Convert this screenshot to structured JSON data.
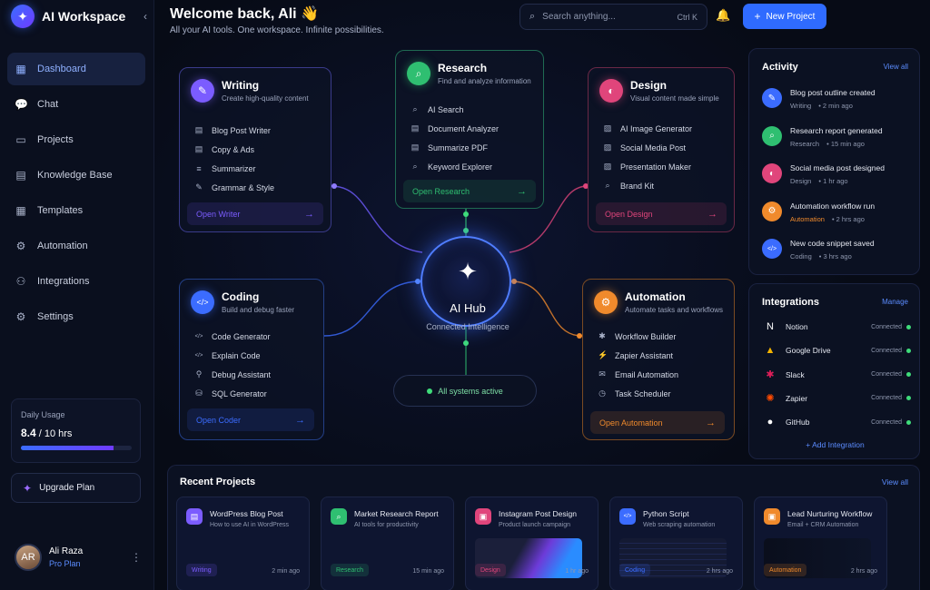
{
  "app": {
    "title": "AI Workspace",
    "collapse_icon": "chevron-left-icon"
  },
  "sidebar": {
    "items": [
      {
        "label": "Dashboard",
        "icon": "grid-icon",
        "glyph": "▦",
        "active": true
      },
      {
        "label": "Chat",
        "icon": "chat-icon",
        "glyph": "💬",
        "active": false
      },
      {
        "label": "Projects",
        "icon": "folder-icon",
        "glyph": "▭",
        "active": false
      },
      {
        "label": "Knowledge Base",
        "icon": "book-icon",
        "glyph": "▤",
        "active": false
      },
      {
        "label": "Templates",
        "icon": "template-icon",
        "glyph": "▦",
        "active": false
      },
      {
        "label": "Automation",
        "icon": "automation-icon",
        "glyph": "⚙",
        "active": false
      },
      {
        "label": "Integrations",
        "icon": "integrations-icon",
        "glyph": "⚇",
        "active": false
      },
      {
        "label": "Settings",
        "icon": "gear-icon",
        "glyph": "⚙",
        "active": false
      }
    ],
    "usage": {
      "label": "Daily Usage",
      "value": "8.4",
      "total": "/ 10 hrs",
      "fraction": 0.84
    },
    "upgrade_label": "Upgrade Plan",
    "user": {
      "name": "Ali Raza",
      "plan": "Pro Plan",
      "initials": "AR"
    }
  },
  "header": {
    "title": "Welcome back, Ali 👋",
    "subtitle": "All your AI tools. One workspace. Infinite possibilities.",
    "search_placeholder": "Search anything...",
    "search_shortcut": "Ctrl K",
    "new_project_label": "New Project"
  },
  "hub": {
    "title": "AI Hub",
    "subtitle": "Connected Intelligence",
    "status": "All systems active"
  },
  "cards": {
    "writing": {
      "title": "Writing",
      "subtitle": "Create high-quality content",
      "items": [
        "Blog Post Writer",
        "Copy & Ads",
        "Summarizer",
        "Grammar & Style"
      ],
      "button": "Open Writer",
      "color": "#7b5cff"
    },
    "research": {
      "title": "Research",
      "subtitle": "Find and analyze information",
      "items": [
        "AI Search",
        "Document Analyzer",
        "Summarize PDF",
        "Keyword Explorer"
      ],
      "button": "Open Research",
      "color": "#2fbf71"
    },
    "design": {
      "title": "Design",
      "subtitle": "Visual content made simple",
      "items": [
        "AI Image Generator",
        "Social Media Post",
        "Presentation Maker",
        "Brand Kit"
      ],
      "button": "Open Design",
      "color": "#e0457b"
    },
    "coding": {
      "title": "Coding",
      "subtitle": "Build and debug faster",
      "items": [
        "Code Generator",
        "Explain Code",
        "Debug Assistant",
        "SQL Generator"
      ],
      "button": "Open Coder",
      "color": "#3b6cff"
    },
    "automation": {
      "title": "Automation",
      "subtitle": "Automate tasks and workflows",
      "items": [
        "Workflow Builder",
        "Zapier Assistant",
        "Email Automation",
        "Task Scheduler"
      ],
      "button": "Open Automation",
      "color": "#f08a2c"
    }
  },
  "activity": {
    "title": "Activity",
    "link": "View all",
    "items": [
      {
        "title": "Blog post outline created",
        "category": "Writing",
        "time": "2 min ago",
        "color": "#3b6cff",
        "icon": "pen-icon"
      },
      {
        "title": "Research report generated",
        "category": "Research",
        "time": "15 min ago",
        "color": "#2fbf71",
        "icon": "search-icon"
      },
      {
        "title": "Social media post designed",
        "category": "Design",
        "time": "1 hr ago",
        "color": "#e0457b",
        "icon": "palette-icon"
      },
      {
        "title": "Automation workflow run",
        "category": "Automation",
        "time": "2 hrs ago",
        "color": "#f08a2c",
        "icon": "gear-icon"
      },
      {
        "title": "New code snippet saved",
        "category": "Coding",
        "time": "3 hrs ago",
        "color": "#3b6cff",
        "icon": "code-icon"
      }
    ]
  },
  "integrations": {
    "title": "Integrations",
    "link": "Manage",
    "items": [
      {
        "name": "Notion",
        "status": "Connected",
        "icon": "notion-icon"
      },
      {
        "name": "Google Drive",
        "status": "Connected",
        "icon": "google-drive-icon"
      },
      {
        "name": "Slack",
        "status": "Connected",
        "icon": "slack-icon"
      },
      {
        "name": "Zapier",
        "status": "Connected",
        "icon": "zapier-icon"
      },
      {
        "name": "GitHub",
        "status": "Connected",
        "icon": "github-icon"
      }
    ],
    "add_label": "+ Add Integration"
  },
  "recent": {
    "title": "Recent Projects",
    "link": "View all",
    "items": [
      {
        "title": "WordPress Blog Post",
        "subtitle": "How to use AI in WordPress",
        "tag": "Writing",
        "time": "2 min ago",
        "color": "#7b5cff"
      },
      {
        "title": "Market Research Report",
        "subtitle": "AI tools for productivity",
        "tag": "Research",
        "time": "15 min ago",
        "color": "#2fbf71"
      },
      {
        "title": "Instagram Post Design",
        "subtitle": "Product launch campaign",
        "tag": "Design",
        "time": "1 hr ago",
        "color": "#e0457b"
      },
      {
        "title": "Python Script",
        "subtitle": "Web scraping automation",
        "tag": "Coding",
        "time": "2 hrs ago",
        "color": "#3b6cff"
      },
      {
        "title": "Lead Nurturing Workflow",
        "subtitle": "Email + CRM Automation",
        "tag": "Automation",
        "time": "2 hrs ago",
        "color": "#f08a2c"
      }
    ]
  }
}
